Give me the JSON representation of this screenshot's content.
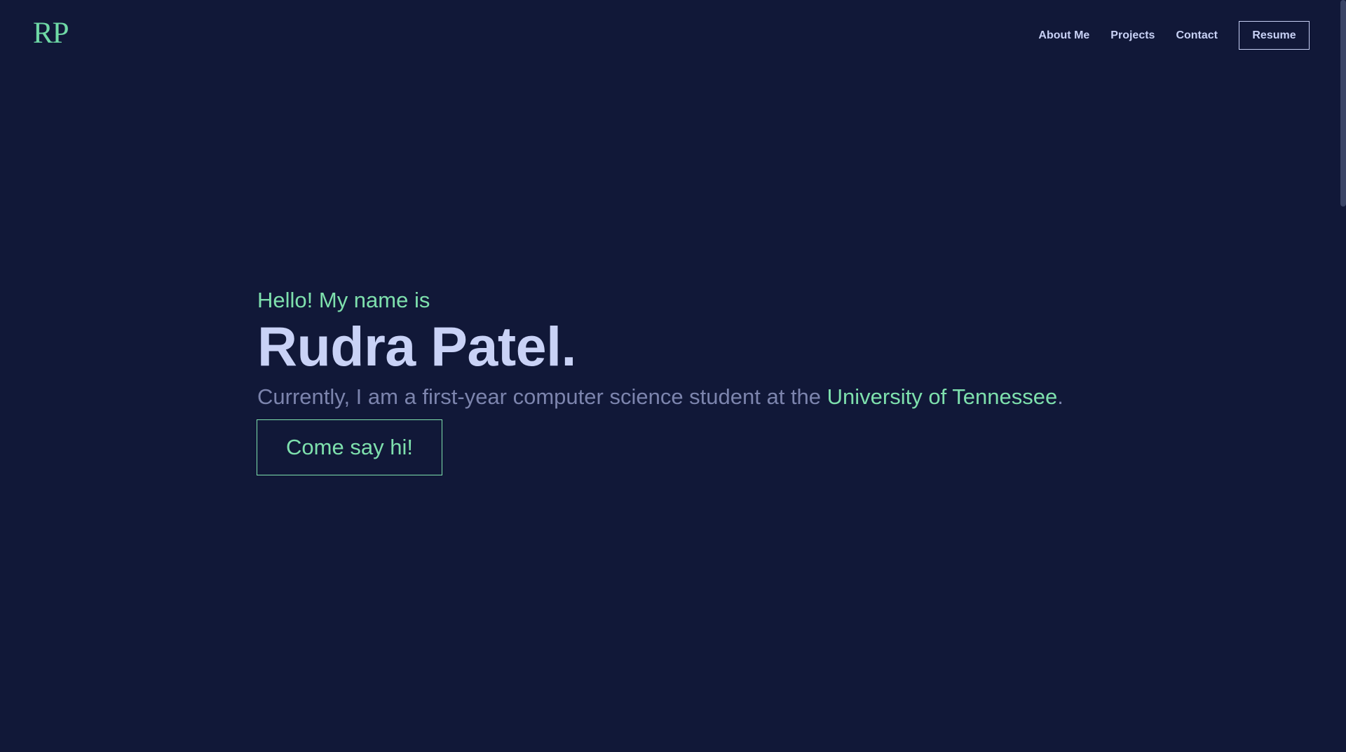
{
  "logo": {
    "text": "RP"
  },
  "nav": {
    "links": [
      {
        "label": "About Me"
      },
      {
        "label": "Projects"
      },
      {
        "label": "Contact"
      }
    ],
    "resume_label": "Resume"
  },
  "hero": {
    "greeting": "Hello! My name is",
    "name": "Rudra Patel.",
    "description_prefix": "Currently, I am a first-year computer science student at the ",
    "description_link": "University of Tennessee",
    "description_suffix": ".",
    "cta_label": "Come say hi!"
  },
  "colors": {
    "background": "#111838",
    "accent": "#7ee0ad",
    "text_primary": "#c9d2f6",
    "text_muted": "#7c84ad"
  }
}
